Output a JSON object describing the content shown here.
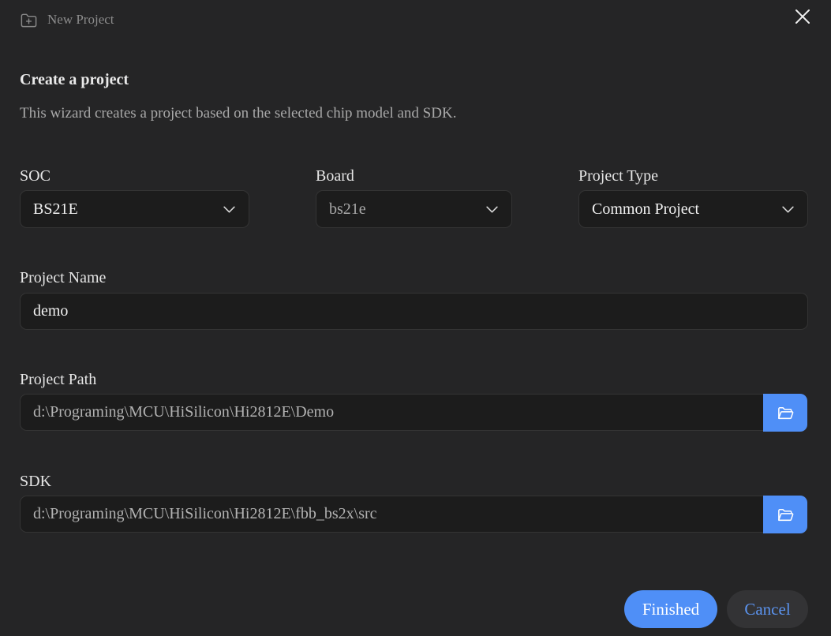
{
  "window": {
    "title": "New Project"
  },
  "header": {
    "heading": "Create a project",
    "description": "This wizard creates a project based on the selected chip model and SDK."
  },
  "form": {
    "soc": {
      "label": "SOC",
      "value": "BS21E"
    },
    "board": {
      "label": "Board",
      "value": "bs21e"
    },
    "project_type": {
      "label": "Project Type",
      "value": "Common Project"
    },
    "project_name": {
      "label": "Project Name",
      "value": "demo"
    },
    "project_path": {
      "label": "Project Path",
      "value": "d:\\Programing\\MCU\\HiSilicon\\Hi2812E\\Demo"
    },
    "sdk": {
      "label": "SDK",
      "value": "d:\\Programing\\MCU\\HiSilicon\\Hi2812E\\fbb_bs2x\\src"
    }
  },
  "footer": {
    "finish_label": "Finished",
    "cancel_label": "Cancel"
  },
  "icons": {
    "title": "folder-plus-icon",
    "close": "close-icon",
    "chevron": "chevron-down-icon",
    "browse": "folder-open-icon"
  },
  "colors": {
    "background": "#252526",
    "field": "#1c1c1c",
    "accent": "#4f8ff7",
    "secondary_button": "#333335"
  }
}
